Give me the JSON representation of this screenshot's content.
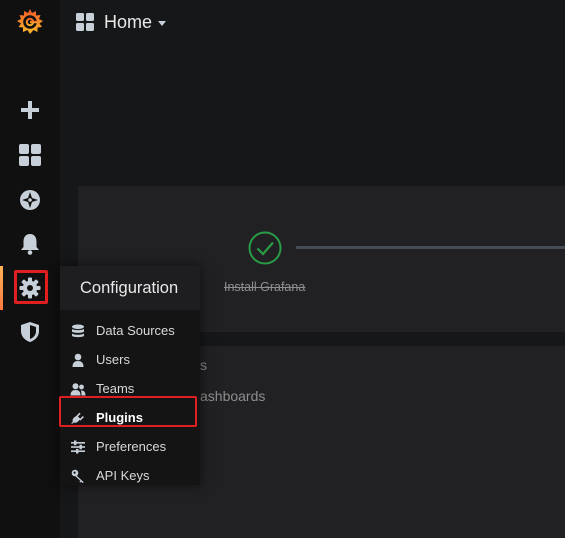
{
  "header": {
    "title": "Home"
  },
  "sidebar": {
    "items": [
      {
        "name": "create",
        "icon": "plus-icon"
      },
      {
        "name": "dashboards",
        "icon": "apps-icon"
      },
      {
        "name": "explore",
        "icon": "compass-icon"
      },
      {
        "name": "alerting",
        "icon": "bell-icon"
      },
      {
        "name": "configuration",
        "icon": "gear-icon",
        "active": true
      },
      {
        "name": "server-admin",
        "icon": "shield-icon"
      }
    ]
  },
  "menu": {
    "title": "Configuration",
    "items": [
      {
        "label": "Data Sources",
        "icon": "database-icon"
      },
      {
        "label": "Users",
        "icon": "user-icon"
      },
      {
        "label": "Teams",
        "icon": "users-icon"
      },
      {
        "label": "Plugins",
        "icon": "plug-icon",
        "highlighted": true
      },
      {
        "label": "Preferences",
        "icon": "sliders-icon"
      },
      {
        "label": "API Keys",
        "icon": "key-icon"
      }
    ]
  },
  "main": {
    "step_label": "Install Grafana",
    "fragment_1": "s",
    "fragment_2": "ashboards"
  },
  "colors": {
    "accent": "#ff7941",
    "success": "#299c46",
    "highlight": "#e02020"
  }
}
